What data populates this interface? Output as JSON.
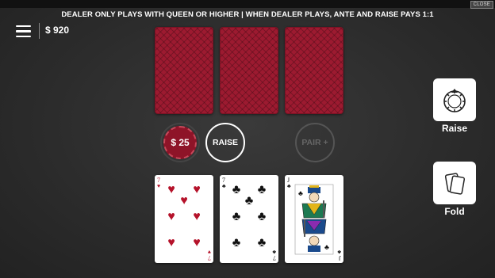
{
  "window": {
    "close_label": "CLOSE"
  },
  "rules_banner": "DEALER ONLY PLAYS WITH QUEEN OR HIGHER | WHEN DEALER PLAYS, ANTE AND RAISE PAYS 1:1",
  "header": {
    "menu_icon": "hamburger-icon",
    "balance": "$ 920"
  },
  "dealer_hand": {
    "face_down_count": 3,
    "back_color": "#9c1a30"
  },
  "bets": {
    "ante_chip": "$ 25",
    "raise_spot": "RAISE",
    "pair_plus_spot": "PAIR +"
  },
  "player_hand": [
    {
      "rank": "7",
      "suit": "hearts",
      "suit_symbol": "♥",
      "color": "#b5122a"
    },
    {
      "rank": "7",
      "suit": "clubs",
      "suit_symbol": "♣",
      "color": "#111111"
    },
    {
      "rank": "J",
      "suit": "clubs",
      "suit_symbol": "♣",
      "color": "#111111"
    }
  ],
  "actions": {
    "raise": {
      "label": "Raise",
      "icon": "chip-stack-icon"
    },
    "fold": {
      "label": "Fold",
      "icon": "fold-cards-icon"
    }
  }
}
